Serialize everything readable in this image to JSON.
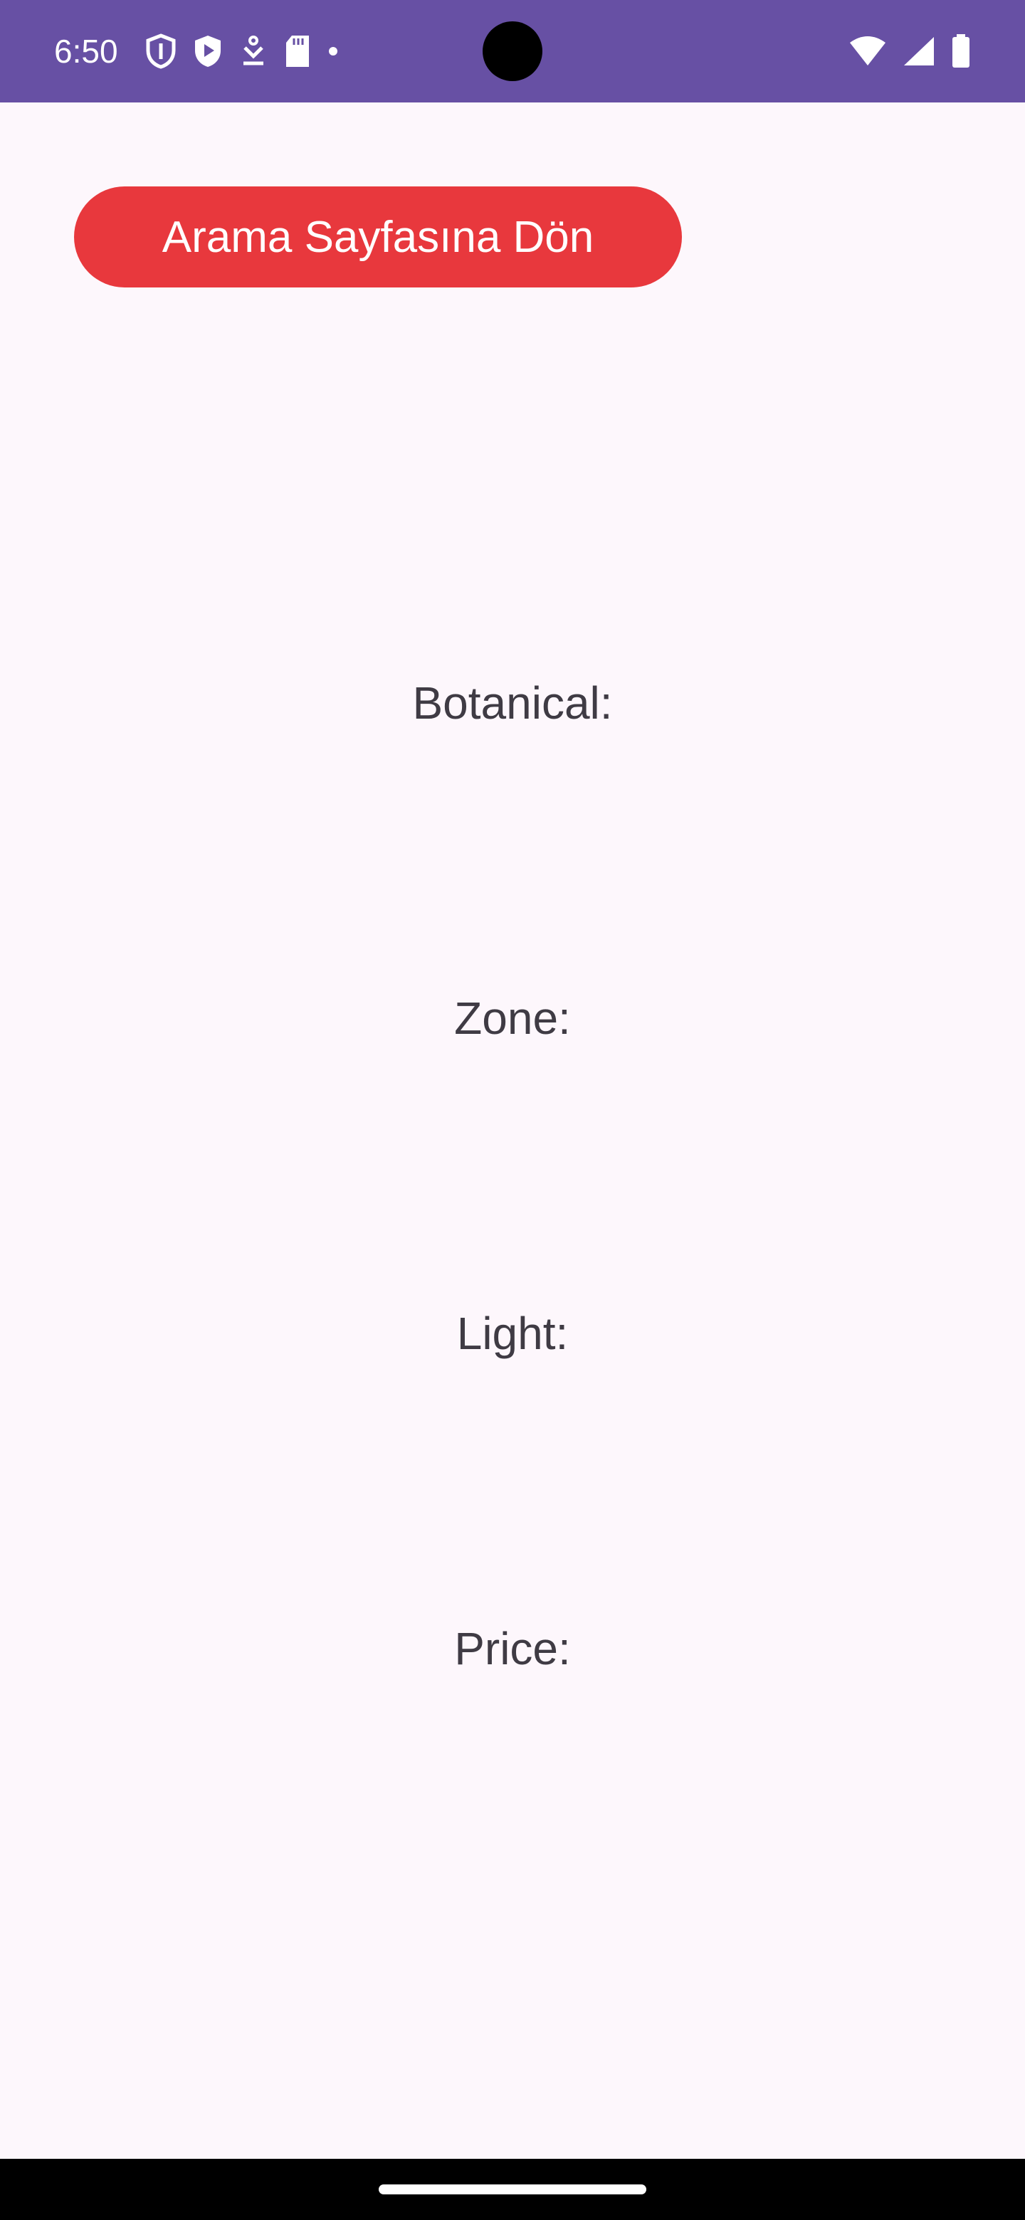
{
  "status_bar": {
    "time": "6:50",
    "background": "#6750a4",
    "left_icons": [
      "shield-outline-icon",
      "play-protect-icon",
      "download-icon",
      "sd-card-icon",
      "dot-icon"
    ],
    "right_icons": [
      "wifi-icon",
      "cellular-signal-icon",
      "battery-icon"
    ]
  },
  "back_button": {
    "label": "Arama Sayfasına Dön",
    "color": "#e8383d"
  },
  "details": {
    "botanical_label": "Botanical:",
    "zone_label": "Zone:",
    "light_label": "Light:",
    "price_label": "Price:"
  },
  "theme": {
    "background": "#fdf7fc",
    "text": "#3f3b44"
  }
}
